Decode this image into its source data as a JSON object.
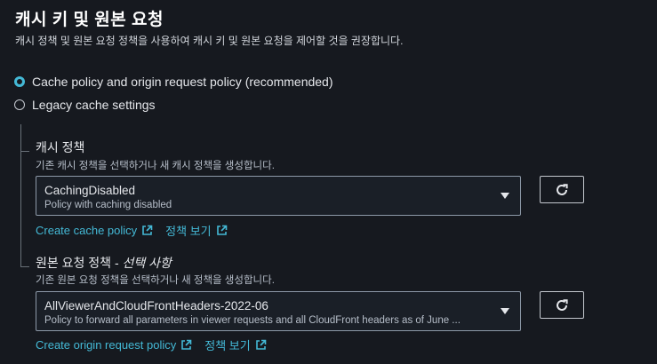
{
  "header": {
    "title": "캐시 키 및 원본 요청",
    "subtitle": "캐시 정책 및 원본 요청 정책을 사용하여 캐시 키 및 원본 요청을 제어할 것을 권장합니다."
  },
  "options": [
    {
      "label": "Cache policy and origin request policy (recommended)",
      "selected": true
    },
    {
      "label": "Legacy cache settings",
      "selected": false
    }
  ],
  "cache_policy": {
    "label": "캐시 정책",
    "description": "기존 캐시 정책을 선택하거나 새 캐시 정책을 생성합니다.",
    "selected_value": "CachingDisabled",
    "selected_description": "Policy with caching disabled",
    "create_link": "Create cache policy",
    "view_link": "정책 보기"
  },
  "origin_request_policy": {
    "label": "원본 요청 정책 - ",
    "label_optional": "선택 사항",
    "description": "기존 원본 요청 정책을 선택하거나 새 정책을 생성합니다.",
    "selected_value": "AllViewerAndCloudFrontHeaders-2022-06",
    "selected_description": "Policy to forward all parameters in viewer requests and all CloudFront headers as of June ...",
    "create_link": "Create origin request policy",
    "view_link": "정책 보기"
  },
  "icons": {
    "refresh": "refresh-icon",
    "external": "external-link-icon",
    "caret": "caret-down-icon"
  },
  "colors": {
    "background": "#16191f",
    "link": "#44b9d6",
    "radio_selected": "#44b9d6"
  }
}
